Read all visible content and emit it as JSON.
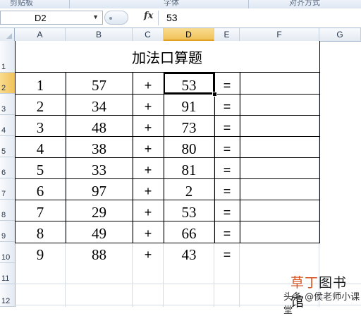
{
  "ribbon": {
    "groups": [
      "剪贴板",
      "字体",
      "对齐方式"
    ]
  },
  "formula_bar": {
    "name_box": "D2",
    "fx": "fx",
    "formula": "53"
  },
  "columns": [
    "A",
    "B",
    "C",
    "D",
    "E",
    "F",
    "G"
  ],
  "rows": [
    "1",
    "2",
    "3",
    "4",
    "5",
    "6",
    "7",
    "8",
    "9",
    "10",
    "11",
    "12"
  ],
  "selected_cell": "D2",
  "sheet": {
    "title": "加法口算题",
    "problems": [
      {
        "no": "1",
        "a": "57",
        "op": "+",
        "b": "53",
        "eq": "="
      },
      {
        "no": "2",
        "a": "34",
        "op": "+",
        "b": "91",
        "eq": "="
      },
      {
        "no": "3",
        "a": "48",
        "op": "+",
        "b": "73",
        "eq": "="
      },
      {
        "no": "4",
        "a": "38",
        "op": "+",
        "b": "80",
        "eq": "="
      },
      {
        "no": "5",
        "a": "33",
        "op": "+",
        "b": "81",
        "eq": "="
      },
      {
        "no": "6",
        "a": "97",
        "op": "+",
        "b": "2",
        "eq": "="
      },
      {
        "no": "7",
        "a": "29",
        "op": "+",
        "b": "53",
        "eq": "="
      },
      {
        "no": "8",
        "a": "49",
        "op": "+",
        "b": "66",
        "eq": "="
      },
      {
        "no": "9",
        "a": "88",
        "op": "+",
        "b": "43",
        "eq": "="
      }
    ]
  },
  "watermark": {
    "brand_part1": "草丁",
    "brand_part2": "图书馆",
    "author": "头条 @侯老师小课堂"
  }
}
